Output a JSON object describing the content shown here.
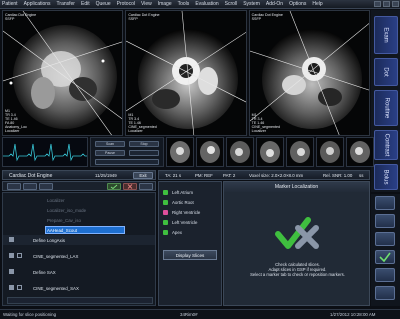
{
  "menubar": {
    "items": [
      "Patient",
      "Applications",
      "Transfer",
      "Edit",
      "Queue",
      "Protocol",
      "View",
      "Image",
      "Tools",
      "Evaluation",
      "Scroll",
      "System",
      "Add-On",
      "Options",
      "Help"
    ]
  },
  "viewers": [
    {
      "tl": "Cardiac Dot Engine\nSSFP\n",
      "bl": "M1\nTR 3.4\nTE 1.46\nFA 80\nAnatomy_Loc\nLocalizer"
    },
    {
      "tl": "Cardiac Dot Engine\nSSFP",
      "bl": "M1\nTR 3.4\nTE 1.46\nCINE_segmented\nLocalizer"
    },
    {
      "tl": "Cardiac Dot Engine\nSSFP",
      "bl": "M1\nTR 3.4\nTE 1.46\nCINE_segmented\nLocalizer"
    }
  ],
  "vtabs": [
    "Exam",
    "Dot",
    "Routine",
    "Contrast",
    "Bolus"
  ],
  "scan_controls": {
    "btn_a": "Scan",
    "btn_b": "Stop",
    "btn_c": "Pause"
  },
  "workflow": {
    "title": "Cardiac Dot Engine",
    "date": "11/25/1949",
    "exit_label": "Exit",
    "tree": [
      {
        "label": "Localizer",
        "dim": true
      },
      {
        "label": "Localizer_iso_mode",
        "dim": true
      },
      {
        "label": "Prepare_Cav_iso",
        "dim": true
      },
      {
        "label": "AAHead_Scout",
        "selected": true
      },
      {
        "label": "Define LongAxis",
        "dim": false
      },
      {
        "label": "CINE_segmented_LAX",
        "dim": false
      },
      {
        "label": "Define SAX",
        "dim": false
      },
      {
        "label": "CINE_segmented_SAX",
        "dim": false
      }
    ]
  },
  "params": {
    "ta": "TA: 21 s",
    "pm": "PM: REF",
    "pat": "PAT: 2",
    "voxel": "Voxel size: 2.0×2.0×8.0 mm",
    "rel_snr": "Rel. SNR: 1.00",
    "mode": "ss"
  },
  "markers": {
    "items": [
      {
        "label": "Left Atrium",
        "color": "#3fbf3f"
      },
      {
        "label": "Aortic Root",
        "color": "#3fbf3f"
      },
      {
        "label": "Right Ventricle",
        "color": "#e04f9b"
      },
      {
        "label": "Left Ventricle",
        "color": "#3fbf3f"
      },
      {
        "label": "Apex",
        "color": "#3fbf3f"
      }
    ],
    "display_slices": "Display Slices"
  },
  "marker_localization": {
    "title": "Marker Localization",
    "message_lines": [
      "Check calculated slices.",
      "Adapt slices in GSP if required.",
      "Select a marker tab to check or reposition markers."
    ]
  },
  "status": {
    "left": "Waiting for slice positioning",
    "center": "34Rim0#",
    "right": "1/27/2012 10:28:00 AM"
  },
  "colors": {
    "accent": "#2a3f86",
    "check_green": "#3fbf3f",
    "cross_gray": "#8a96a8"
  }
}
